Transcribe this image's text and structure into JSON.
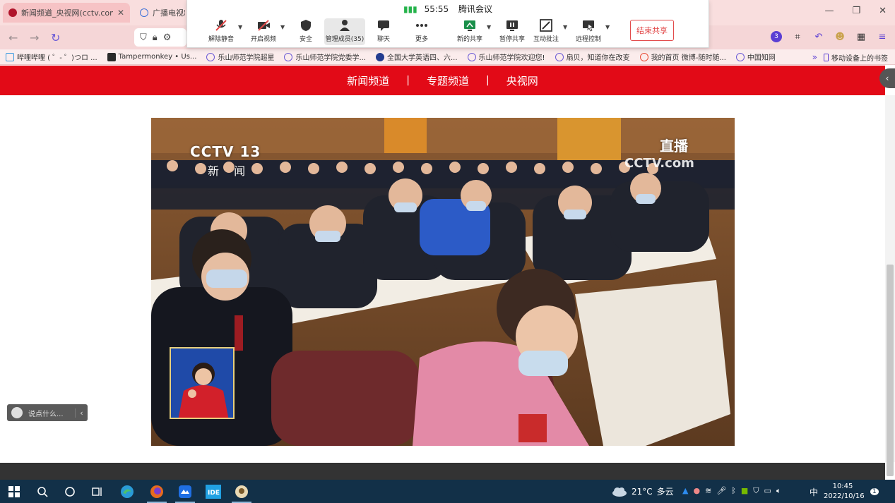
{
  "browser": {
    "tabs": [
      {
        "title": "新闻频道_央视网(cctv.com)",
        "active": true
      },
      {
        "title": "广播电视新",
        "active": false
      }
    ],
    "bookmarks": [
      "哔哩哔哩 ( ゜- ゜)つロ ...",
      "Tampermonkey • Us...",
      "乐山师范学院超星",
      "乐山师范学院党委学...",
      "全国大学英语四、六...",
      "乐山师范学院欢迎您!",
      "扇贝，知道你在改变",
      "我的首页 微博-随时随...",
      "中国知网"
    ],
    "bookmarks_more": "»",
    "mobile_bookmarks": "移动设备上的书签",
    "badge_count": "3"
  },
  "meeting": {
    "timer": "55:55",
    "app_name": "腾讯会议",
    "buttons": {
      "unmute": "解除静音",
      "video": "开启视频",
      "security": "安全",
      "members": "管理成员(35)",
      "chat": "聊天",
      "more": "更多",
      "new_share": "新的共享",
      "pause_share": "暂停共享",
      "annotate": "互动批注",
      "remote": "远程控制"
    },
    "end_share": "结束共享"
  },
  "page": {
    "nav": [
      "新闻频道",
      "专题频道",
      "央视网"
    ],
    "nav_sep": "|",
    "video": {
      "channel_logo": "CCTV 13",
      "channel_sub": "新 闻",
      "live_badge": "直播",
      "watermark": "CCTV.com"
    },
    "chat_placeholder": "说点什么..."
  },
  "taskbar": {
    "weather_temp": "21°C",
    "weather_desc": "多云",
    "ime": "中",
    "time": "10:45",
    "date": "2022/10/16",
    "notification_count": "1"
  }
}
